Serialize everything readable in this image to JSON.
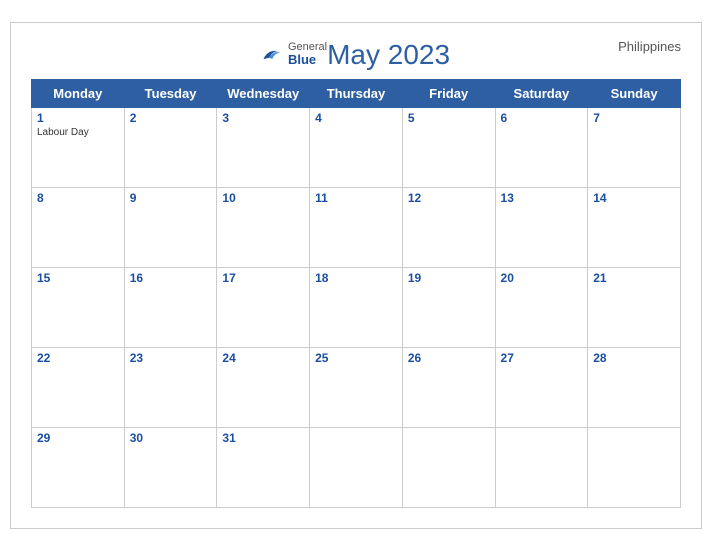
{
  "calendar": {
    "title": "May 2023",
    "country": "Philippines",
    "logo": {
      "general": "General",
      "blue": "Blue"
    },
    "days_of_week": [
      "Monday",
      "Tuesday",
      "Wednesday",
      "Thursday",
      "Friday",
      "Saturday",
      "Sunday"
    ],
    "weeks": [
      [
        {
          "day": "1",
          "holiday": "Labour Day"
        },
        {
          "day": "2",
          "holiday": ""
        },
        {
          "day": "3",
          "holiday": ""
        },
        {
          "day": "4",
          "holiday": ""
        },
        {
          "day": "5",
          "holiday": ""
        },
        {
          "day": "6",
          "holiday": ""
        },
        {
          "day": "7",
          "holiday": ""
        }
      ],
      [
        {
          "day": "8",
          "holiday": ""
        },
        {
          "day": "9",
          "holiday": ""
        },
        {
          "day": "10",
          "holiday": ""
        },
        {
          "day": "11",
          "holiday": ""
        },
        {
          "day": "12",
          "holiday": ""
        },
        {
          "day": "13",
          "holiday": ""
        },
        {
          "day": "14",
          "holiday": ""
        }
      ],
      [
        {
          "day": "15",
          "holiday": ""
        },
        {
          "day": "16",
          "holiday": ""
        },
        {
          "day": "17",
          "holiday": ""
        },
        {
          "day": "18",
          "holiday": ""
        },
        {
          "day": "19",
          "holiday": ""
        },
        {
          "day": "20",
          "holiday": ""
        },
        {
          "day": "21",
          "holiday": ""
        }
      ],
      [
        {
          "day": "22",
          "holiday": ""
        },
        {
          "day": "23",
          "holiday": ""
        },
        {
          "day": "24",
          "holiday": ""
        },
        {
          "day": "25",
          "holiday": ""
        },
        {
          "day": "26",
          "holiday": ""
        },
        {
          "day": "27",
          "holiday": ""
        },
        {
          "day": "28",
          "holiday": ""
        }
      ],
      [
        {
          "day": "29",
          "holiday": ""
        },
        {
          "day": "30",
          "holiday": ""
        },
        {
          "day": "31",
          "holiday": ""
        },
        {
          "day": "",
          "holiday": ""
        },
        {
          "day": "",
          "holiday": ""
        },
        {
          "day": "",
          "holiday": ""
        },
        {
          "day": "",
          "holiday": ""
        }
      ]
    ]
  }
}
